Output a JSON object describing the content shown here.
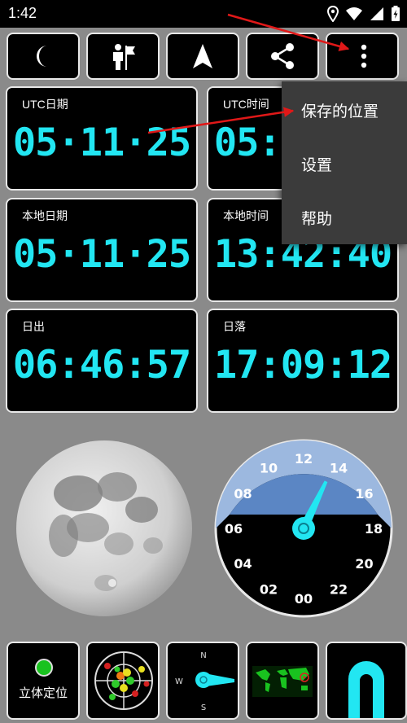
{
  "status_bar": {
    "time": "1:42"
  },
  "toolbar": {
    "buttons": [
      {
        "icon": "moon-icon"
      },
      {
        "icon": "person-flag-icon"
      },
      {
        "icon": "navigation-arrow-icon"
      },
      {
        "icon": "share-icon"
      },
      {
        "icon": "more-vert-icon"
      }
    ]
  },
  "panels": [
    {
      "label": "UTC日期",
      "value": "05·11·25"
    },
    {
      "label": "UTC时间",
      "value": "05:42:40"
    },
    {
      "label": "本地日期",
      "value": "05·11·25"
    },
    {
      "label": "本地时间",
      "value": "13:42:40"
    },
    {
      "label": "日出",
      "value": "06:46:57"
    },
    {
      "label": "日落",
      "value": "17:09:12"
    }
  ],
  "overflow_menu": {
    "items": [
      {
        "label": "保存的位置"
      },
      {
        "label": "设置"
      },
      {
        "label": "帮助"
      }
    ]
  },
  "dial": {
    "hour_labels": [
      "12",
      "14",
      "16",
      "18",
      "20",
      "22",
      "00",
      "02",
      "04",
      "06",
      "08",
      "10"
    ],
    "hand_hour": 13.7,
    "day_color": "#5b86c4",
    "twilight_color": "#9cb8df",
    "hand_color": "#22e6f2"
  },
  "bottom_bar": {
    "stereo_label": "立体定位",
    "compass_n": "N",
    "compass_w": "W",
    "compass_s": "S"
  },
  "colors": {
    "accent": "#22e6f2",
    "background": "#8a8a8a",
    "tile": "#000000",
    "menu": "#3b3b3b"
  }
}
